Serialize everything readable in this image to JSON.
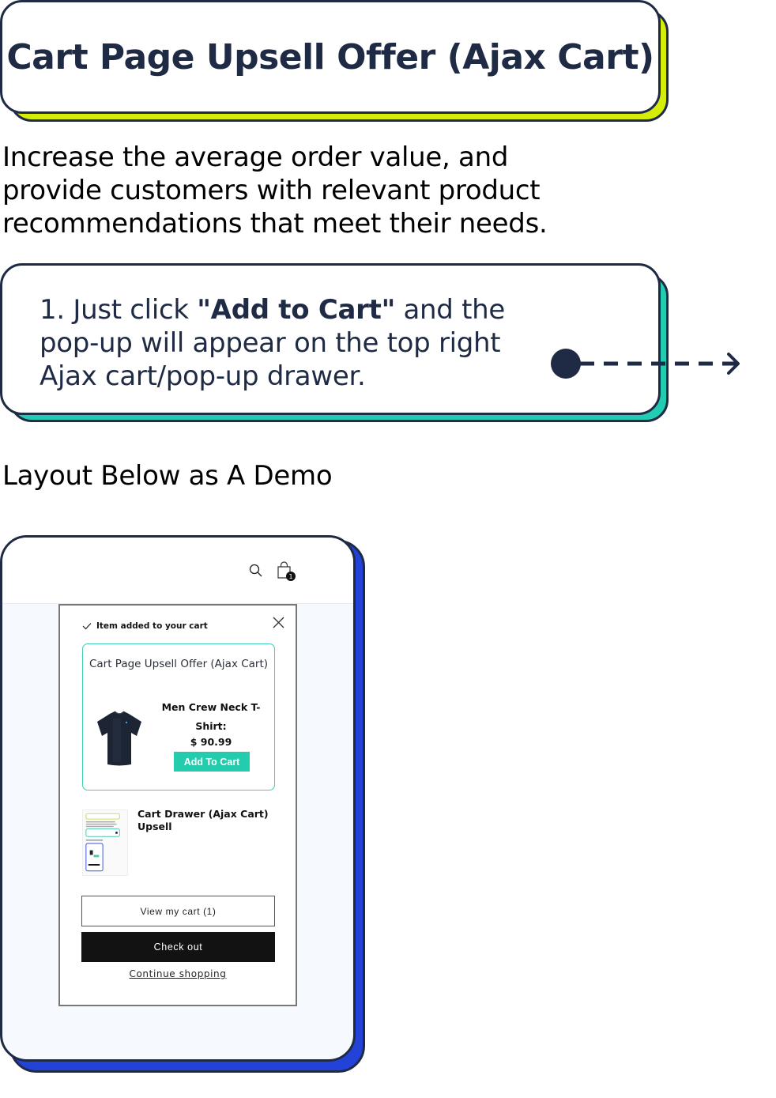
{
  "title": "Cart Page Upsell Offer (Ajax Cart)",
  "intro": "Increase the average order value, and provide customers with relevant product recommendations that meet their needs.",
  "step": {
    "prefix": "1. Just click ",
    "highlight": "\"Add to Cart\"",
    "suffix": " and the pop-up will appear on the top right Ajax cart/pop-up drawer."
  },
  "layout_label": "Layout Below as A Demo",
  "colors": {
    "navy": "#1f2a44",
    "lime": "#d4ee0a",
    "teal": "#22ccb0",
    "blue": "#2342d8"
  },
  "demo": {
    "header_icons": [
      "search-icon",
      "shopping-bag-icon"
    ],
    "cart_count": "1",
    "popup": {
      "added_message": "Item added to your cart",
      "upsell_title": "Cart Page Upsell Offer (Ajax Cart)",
      "product_name": "Men Crew Neck T-Shirt:",
      "product_price": "$ 90.99",
      "add_to_cart_label": "Add To Cart",
      "drawer_item_title": "Cart Drawer (Ajax Cart) Upsell",
      "view_cart_label": "View my cart (1)",
      "checkout_label": "Check out",
      "continue_label": "Continue shopping"
    }
  }
}
